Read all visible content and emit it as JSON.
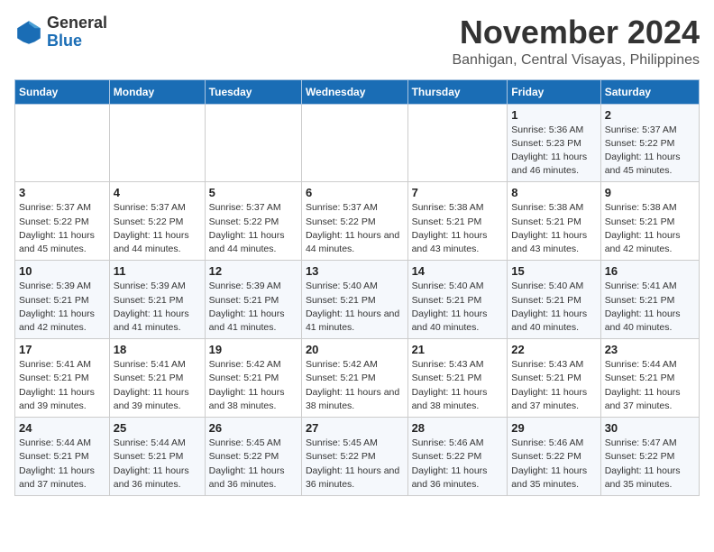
{
  "logo": {
    "text_general": "General",
    "text_blue": "Blue"
  },
  "title": "November 2024",
  "location": "Banhigan, Central Visayas, Philippines",
  "days_of_week": [
    "Sunday",
    "Monday",
    "Tuesday",
    "Wednesday",
    "Thursday",
    "Friday",
    "Saturday"
  ],
  "weeks": [
    [
      {
        "day": "",
        "info": ""
      },
      {
        "day": "",
        "info": ""
      },
      {
        "day": "",
        "info": ""
      },
      {
        "day": "",
        "info": ""
      },
      {
        "day": "",
        "info": ""
      },
      {
        "day": "1",
        "info": "Sunrise: 5:36 AM\nSunset: 5:23 PM\nDaylight: 11 hours and 46 minutes."
      },
      {
        "day": "2",
        "info": "Sunrise: 5:37 AM\nSunset: 5:22 PM\nDaylight: 11 hours and 45 minutes."
      }
    ],
    [
      {
        "day": "3",
        "info": "Sunrise: 5:37 AM\nSunset: 5:22 PM\nDaylight: 11 hours and 45 minutes."
      },
      {
        "day": "4",
        "info": "Sunrise: 5:37 AM\nSunset: 5:22 PM\nDaylight: 11 hours and 44 minutes."
      },
      {
        "day": "5",
        "info": "Sunrise: 5:37 AM\nSunset: 5:22 PM\nDaylight: 11 hours and 44 minutes."
      },
      {
        "day": "6",
        "info": "Sunrise: 5:37 AM\nSunset: 5:22 PM\nDaylight: 11 hours and 44 minutes."
      },
      {
        "day": "7",
        "info": "Sunrise: 5:38 AM\nSunset: 5:21 PM\nDaylight: 11 hours and 43 minutes."
      },
      {
        "day": "8",
        "info": "Sunrise: 5:38 AM\nSunset: 5:21 PM\nDaylight: 11 hours and 43 minutes."
      },
      {
        "day": "9",
        "info": "Sunrise: 5:38 AM\nSunset: 5:21 PM\nDaylight: 11 hours and 42 minutes."
      }
    ],
    [
      {
        "day": "10",
        "info": "Sunrise: 5:39 AM\nSunset: 5:21 PM\nDaylight: 11 hours and 42 minutes."
      },
      {
        "day": "11",
        "info": "Sunrise: 5:39 AM\nSunset: 5:21 PM\nDaylight: 11 hours and 41 minutes."
      },
      {
        "day": "12",
        "info": "Sunrise: 5:39 AM\nSunset: 5:21 PM\nDaylight: 11 hours and 41 minutes."
      },
      {
        "day": "13",
        "info": "Sunrise: 5:40 AM\nSunset: 5:21 PM\nDaylight: 11 hours and 41 minutes."
      },
      {
        "day": "14",
        "info": "Sunrise: 5:40 AM\nSunset: 5:21 PM\nDaylight: 11 hours and 40 minutes."
      },
      {
        "day": "15",
        "info": "Sunrise: 5:40 AM\nSunset: 5:21 PM\nDaylight: 11 hours and 40 minutes."
      },
      {
        "day": "16",
        "info": "Sunrise: 5:41 AM\nSunset: 5:21 PM\nDaylight: 11 hours and 40 minutes."
      }
    ],
    [
      {
        "day": "17",
        "info": "Sunrise: 5:41 AM\nSunset: 5:21 PM\nDaylight: 11 hours and 39 minutes."
      },
      {
        "day": "18",
        "info": "Sunrise: 5:41 AM\nSunset: 5:21 PM\nDaylight: 11 hours and 39 minutes."
      },
      {
        "day": "19",
        "info": "Sunrise: 5:42 AM\nSunset: 5:21 PM\nDaylight: 11 hours and 38 minutes."
      },
      {
        "day": "20",
        "info": "Sunrise: 5:42 AM\nSunset: 5:21 PM\nDaylight: 11 hours and 38 minutes."
      },
      {
        "day": "21",
        "info": "Sunrise: 5:43 AM\nSunset: 5:21 PM\nDaylight: 11 hours and 38 minutes."
      },
      {
        "day": "22",
        "info": "Sunrise: 5:43 AM\nSunset: 5:21 PM\nDaylight: 11 hours and 37 minutes."
      },
      {
        "day": "23",
        "info": "Sunrise: 5:44 AM\nSunset: 5:21 PM\nDaylight: 11 hours and 37 minutes."
      }
    ],
    [
      {
        "day": "24",
        "info": "Sunrise: 5:44 AM\nSunset: 5:21 PM\nDaylight: 11 hours and 37 minutes."
      },
      {
        "day": "25",
        "info": "Sunrise: 5:44 AM\nSunset: 5:21 PM\nDaylight: 11 hours and 36 minutes."
      },
      {
        "day": "26",
        "info": "Sunrise: 5:45 AM\nSunset: 5:22 PM\nDaylight: 11 hours and 36 minutes."
      },
      {
        "day": "27",
        "info": "Sunrise: 5:45 AM\nSunset: 5:22 PM\nDaylight: 11 hours and 36 minutes."
      },
      {
        "day": "28",
        "info": "Sunrise: 5:46 AM\nSunset: 5:22 PM\nDaylight: 11 hours and 36 minutes."
      },
      {
        "day": "29",
        "info": "Sunrise: 5:46 AM\nSunset: 5:22 PM\nDaylight: 11 hours and 35 minutes."
      },
      {
        "day": "30",
        "info": "Sunrise: 5:47 AM\nSunset: 5:22 PM\nDaylight: 11 hours and 35 minutes."
      }
    ]
  ]
}
